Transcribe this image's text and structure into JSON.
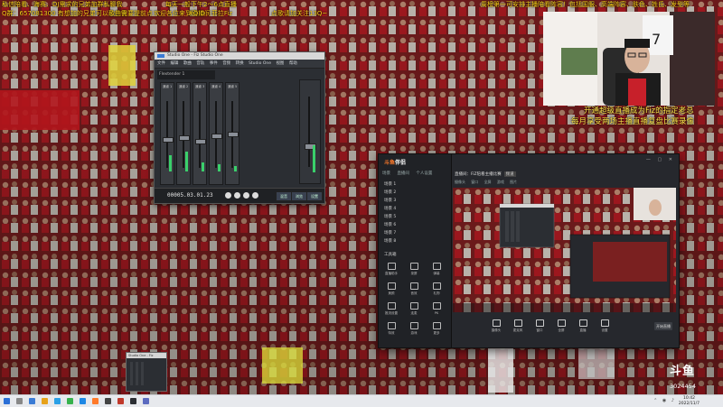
{
  "overlay_text": {
    "top_left_1": "私信陪看、海赛、DJ需求的兄弟加群私聊我",
    "top_left_2": "Q群：657081300  有想加的兄弟可以私信我",
    "top_center_1": "每天一般下午2～6点直播",
    "top_center_2": "歌曲需要提前点",
    "top_center_3": "欢迎各位来到直播间",
    "top_center_4": "#QID：菲拉Fiz",
    "top_follow": "点歌请加关注13Q~",
    "top_right_1": "周榜第一可安排主播陪看阵容！包括国服、高端阵容、肤色、姓氏、发型等",
    "right_1": "开通超级直播成为Fiz的指定老总",
    "right_2": "每月享受两场主播直播复盘比赛录像"
  },
  "studio_one": {
    "title": "Studio One - Fiz Studio One",
    "menu": [
      "文件",
      "编辑",
      "歌曲",
      "音轨",
      "事件",
      "音频",
      "转换",
      "Studio One",
      "视图",
      "帮助"
    ],
    "inspector": "Flextender 1",
    "channels": [
      "通道 1",
      "通道 2",
      "通道 3",
      "通道 4",
      "通道 5"
    ],
    "time": "00005.03.01.23",
    "right_buttons": [
      "混音",
      "浏览",
      "设置"
    ]
  },
  "broadcast_app": {
    "logo_prefix": "斗鱼",
    "logo_suffix": "伴侣",
    "tabs": [
      "场景",
      "直播间",
      "个人设置"
    ],
    "scenes": [
      "场景 1",
      "场景 2",
      "场景 3",
      "场景 4",
      "场景 5",
      "场景 6",
      "场景 7",
      "场景 8",
      "场景 9"
    ],
    "tools_label": "工具箱",
    "tools": [
      "直播助手",
      "录屏",
      "弹幕",
      "美颜",
      "音效",
      "礼物",
      "推流设置",
      "连麦",
      "PK",
      "特效",
      "游戏",
      "更多"
    ],
    "room_title": "直播间：FiZ陪看主播比赛",
    "room_tag": "频道",
    "subtabs": [
      "摄像头",
      "窗口",
      "全屏",
      "游戏",
      "图片"
    ],
    "controls": [
      "摄像头",
      "麦克风",
      "窗口",
      "全屏",
      "直播",
      "设置"
    ],
    "live_button": "开始直播"
  },
  "thumbnail_window": {
    "title": "Studio One - Fiz"
  },
  "douyu": {
    "logo": "斗鱼",
    "id": "3024454"
  },
  "taskbar": {
    "time": "10:42",
    "date": "2022/11/7"
  }
}
